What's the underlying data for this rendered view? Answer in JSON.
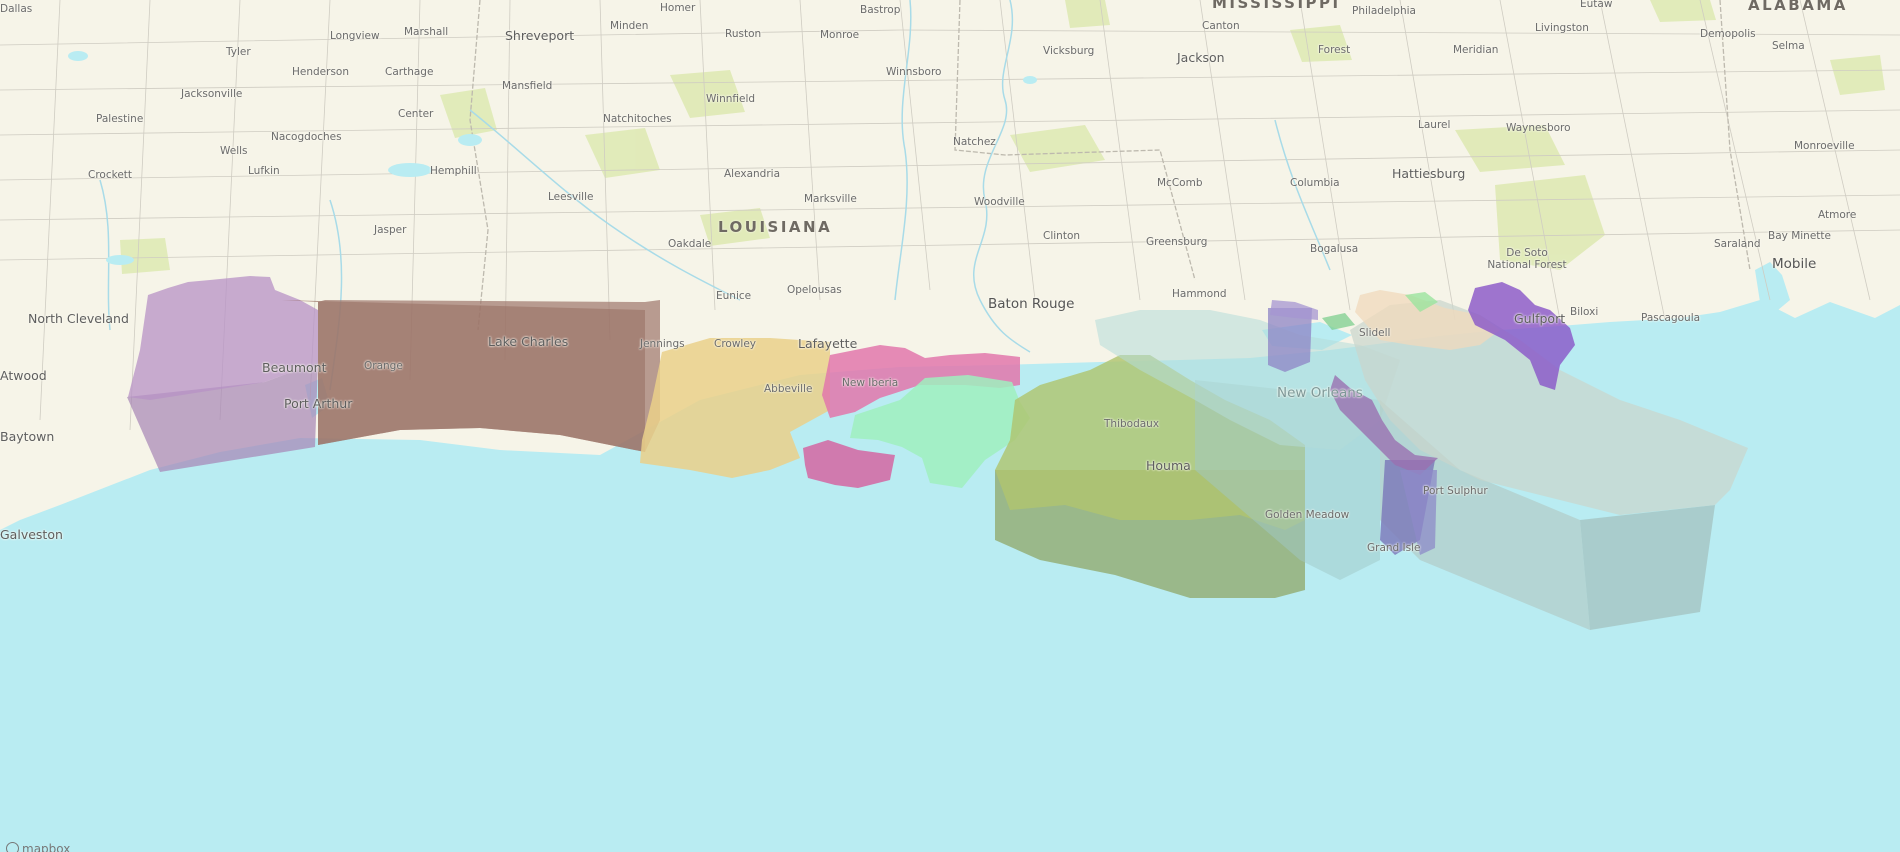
{
  "map": {
    "land_color": "#f6f4e8",
    "water_color": "#b9ecf2",
    "park_color": "#dfeab5",
    "boundary_color": "#c9c6bd",
    "river_color": "#a8dbe8"
  },
  "states": [
    "LOUISIANA",
    "MISSISSIPPI",
    "ALABAMA"
  ],
  "cities": [
    "Dallas",
    "Homer",
    "Bastrop",
    "Eutaw",
    "Philadelphia",
    "Canton",
    "Marshall",
    "Minden",
    "Ruston",
    "Shreveport",
    "Monroe",
    "Vicksburg",
    "Jackson",
    "Livingston",
    "Demopolis",
    "Tyler",
    "Longview",
    "Forest",
    "Meridian",
    "Selma",
    "Henderson",
    "Carthage",
    "Winnsboro",
    "Jacksonville",
    "Mansfield",
    "Winnfield",
    "Palestine",
    "Center",
    "Natchitoches",
    "Laurel",
    "Waynesboro",
    "Natchez",
    "Monroeville",
    "Wells",
    "Nacogdoches",
    "Lufkin",
    "Hemphill",
    "Crockett",
    "Alexandria",
    "McComb",
    "Columbia",
    "Hattiesburg",
    "Leesville",
    "Marksville",
    "Woodville",
    "Jasper",
    "Clinton",
    "Greensburg",
    "Atmore",
    "Oakdale",
    "De Soto National Forest",
    "Bay Minette",
    "Bogalusa",
    "Saraland",
    "Mobile",
    "North Cleveland",
    "Eunice",
    "Opelousas",
    "Baton Rouge",
    "Hammond",
    "Slidell",
    "Gulfport",
    "Biloxi",
    "Pascagoula",
    "Beaumont",
    "Orange",
    "Lake Charles",
    "Jennings",
    "Crowley",
    "Lafayette",
    "Baytown",
    "Port Arthur",
    "Abbeville",
    "New Iberia",
    "Thibodaux",
    "New Orleans",
    "Houma",
    "Port Sulphur",
    "Golden Meadow",
    "Grand Isle",
    "Galveston",
    "Atwood"
  ],
  "attribution": "mapbox"
}
